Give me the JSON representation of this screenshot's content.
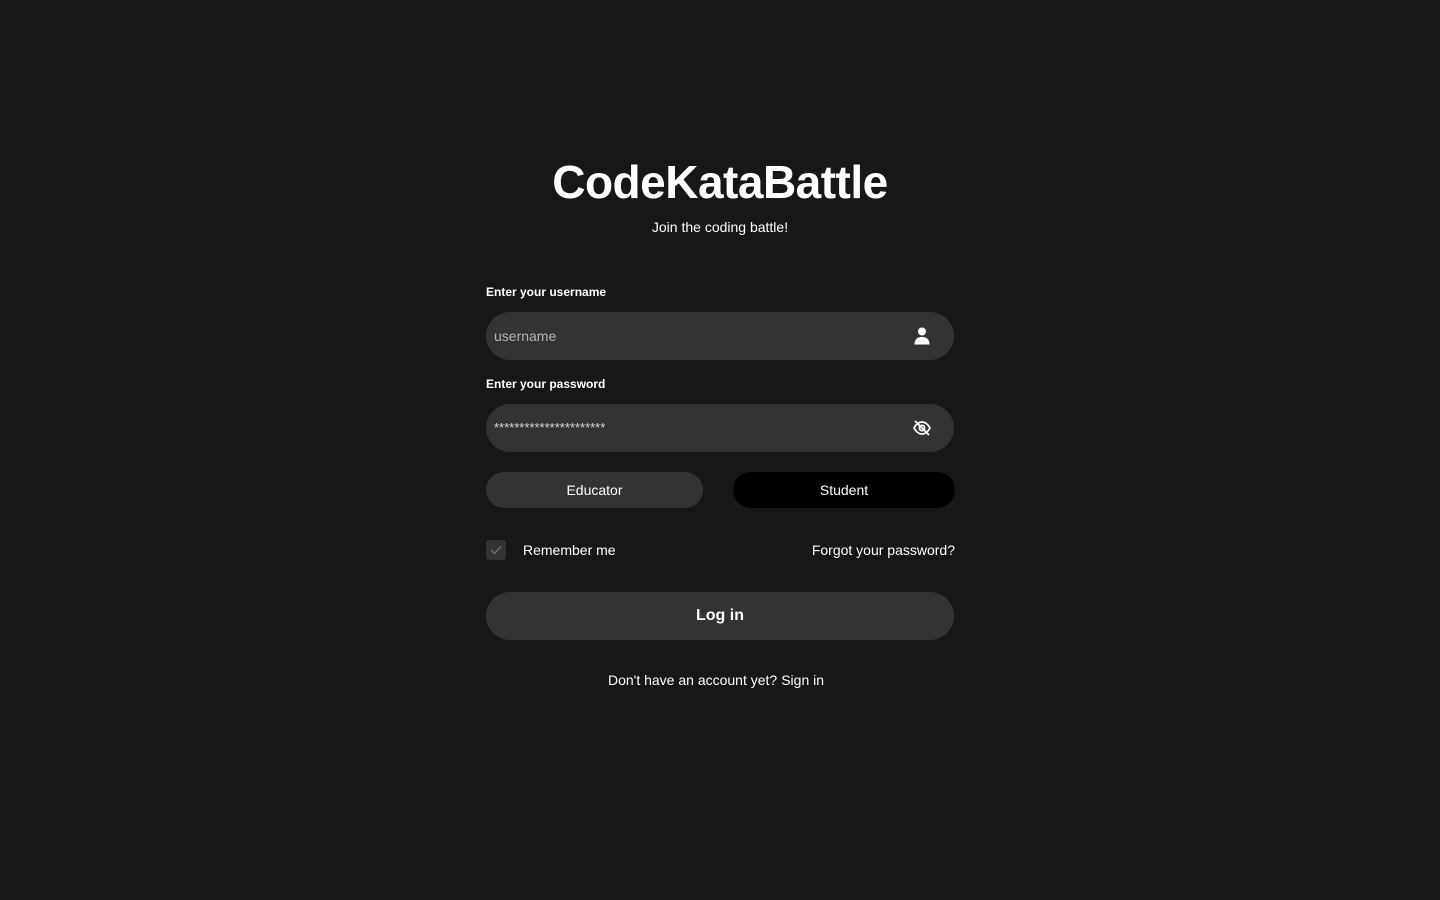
{
  "header": {
    "title": "CodeKataBattle",
    "subtitle": "Join the coding battle!"
  },
  "username": {
    "label": "Enter your username",
    "placeholder": "username",
    "value": "",
    "icon": "user-icon"
  },
  "password": {
    "label": "Enter your password",
    "value": "**********************",
    "icon": "eye-off-icon"
  },
  "roles": {
    "educator_label": "Educator",
    "student_label": "Student",
    "selected": "Student"
  },
  "remember": {
    "label": "Remember me",
    "checked": true
  },
  "forgot_label": "Forgot your password?",
  "login_label": "Log in",
  "signup": {
    "prompt": "Don't have an account yet?",
    "link_label": "Sign in"
  },
  "colors": {
    "background": "#171717",
    "field": "#333333",
    "selected_role": "#000000",
    "text": "#ffffff"
  }
}
